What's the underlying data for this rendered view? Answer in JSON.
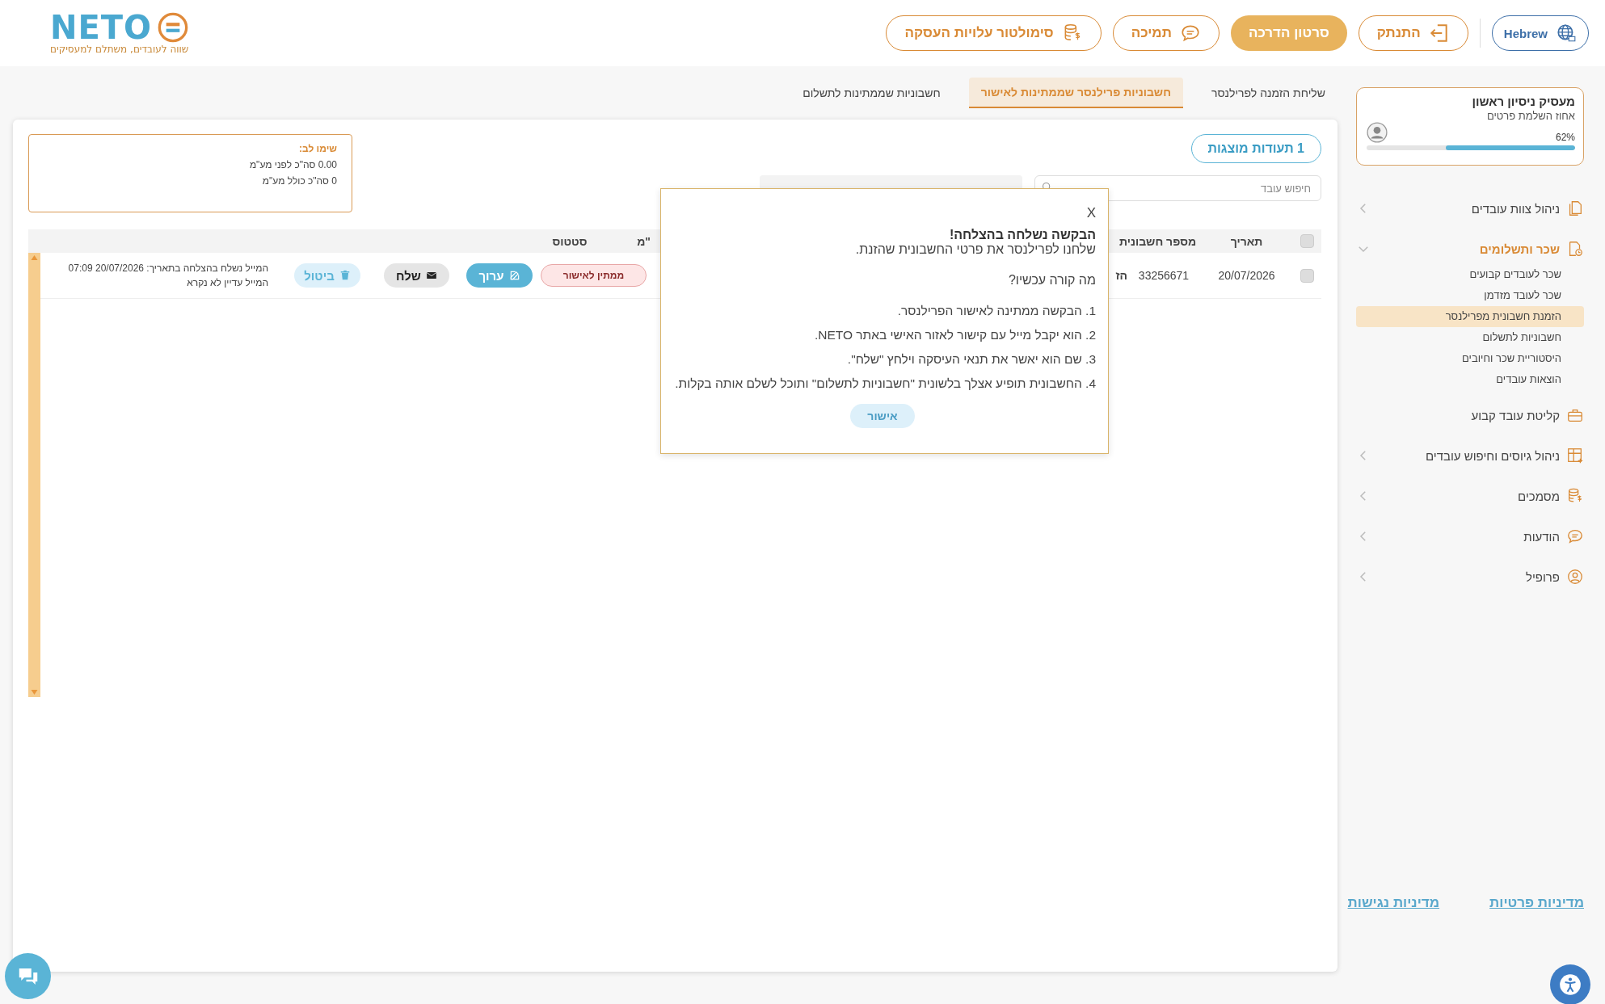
{
  "header": {
    "logo": {
      "name": "NETO",
      "tagline": "שווה לעובדים, משתלם למעסיקים"
    },
    "buttons": [
      {
        "kind": "language",
        "label": "Hebrew"
      },
      {
        "kind": "outline",
        "label": "התנתק"
      },
      {
        "kind": "filled",
        "label": "סרטון הדרכה"
      },
      {
        "kind": "outline",
        "label": "תמיכה"
      },
      {
        "kind": "outline",
        "label": "סימולטור עלויות העסקה"
      }
    ]
  },
  "sidebar": {
    "profile": {
      "name": "מעסיק ניסיון ראשון",
      "subtitle": "אחוז השלמת פרטים",
      "percent": "62%",
      "level": 0.62
    },
    "items": [
      {
        "kind": "group",
        "label": "ניהול צוות עובדים",
        "expanded": false
      },
      {
        "kind": "group",
        "label": "שכר ותשלומים",
        "expanded": true,
        "children": [
          {
            "label": "שכר לעובדים קבועים",
            "selected": false
          },
          {
            "label": "שכר לעובד מזדמן",
            "selected": false
          },
          {
            "label": "הזמנת חשבונית מפרילנסר",
            "selected": true
          },
          {
            "label": "חשבוניות לתשלום",
            "selected": false
          },
          {
            "label": "היסטוריית שכר וחיובים",
            "selected": false
          },
          {
            "label": "הוצאות עובדים",
            "selected": false
          }
        ]
      },
      {
        "kind": "link",
        "label": "קליטת עובד קבוע"
      },
      {
        "kind": "group",
        "label": "ניהול גיוסים וחיפוש עובדים",
        "expanded": false
      },
      {
        "kind": "group",
        "label": "מסמכים",
        "expanded": false
      },
      {
        "kind": "group",
        "label": "הודעות",
        "expanded": false
      },
      {
        "kind": "group",
        "label": "פרופיל",
        "expanded": false
      }
    ],
    "links": [
      "מדיניות פרטיות",
      "מדיניות נגישות"
    ]
  },
  "tabs": [
    {
      "label": "שליחת הזמנה לפרילנסר",
      "selected": false
    },
    {
      "label": "חשבוניות פרילנסר שממתינות לאישור",
      "selected": true
    },
    {
      "label": "חשבוניות שממתינות לתשלום",
      "selected": false
    }
  ],
  "results_button": "1 תעודות מוצגות",
  "note": {
    "title": "שימו לב:",
    "lines": [
      "0.00 סה\"כ לפני מע\"מ",
      "0 סה\"כ כולל מע\"מ"
    ]
  },
  "search": {
    "placeholder": "חיפוש עובד"
  },
  "table": {
    "select_all": {
      "checked": false
    },
    "columns": [
      "תאריך",
      "מספר חשבונית",
      "\"מ",
      "סטטוס"
    ],
    "rows": [
      {
        "checked": false,
        "date": "20/07/2026",
        "invoice_number": "33256671",
        "column_3": "הז",
        "status": "ממתין לאישור",
        "actions": [
          "ערוך",
          "שלח",
          "ביטול"
        ],
        "message": [
          "המייל נשלח בהצלחה בתאריך: 20/07/2026 07:09",
          "המייל עדיין לא נקרא"
        ]
      }
    ]
  },
  "modal": {
    "close": "X",
    "title": "הבקשה נשלחה בהצלחה!",
    "subtitle": "שלחנו לפרילנסר את פרטי החשבונית שהזנת.",
    "question": "מה קורה עכשיו?",
    "steps": [
      "1. הבקשה ממתינה לאישור הפרילנסר.",
      "2. הוא יקבל מייל עם קישור לאזור האישי באתר NETO.",
      "3. שם הוא יאשר את תנאי העיסקה וילחץ \"שלח\".",
      "4. החשבונית תופיע אצלך בלשונית \"חשבוניות לתשלום\" ותוכל לשלם אותה בקלות."
    ],
    "ok": "אישור"
  }
}
